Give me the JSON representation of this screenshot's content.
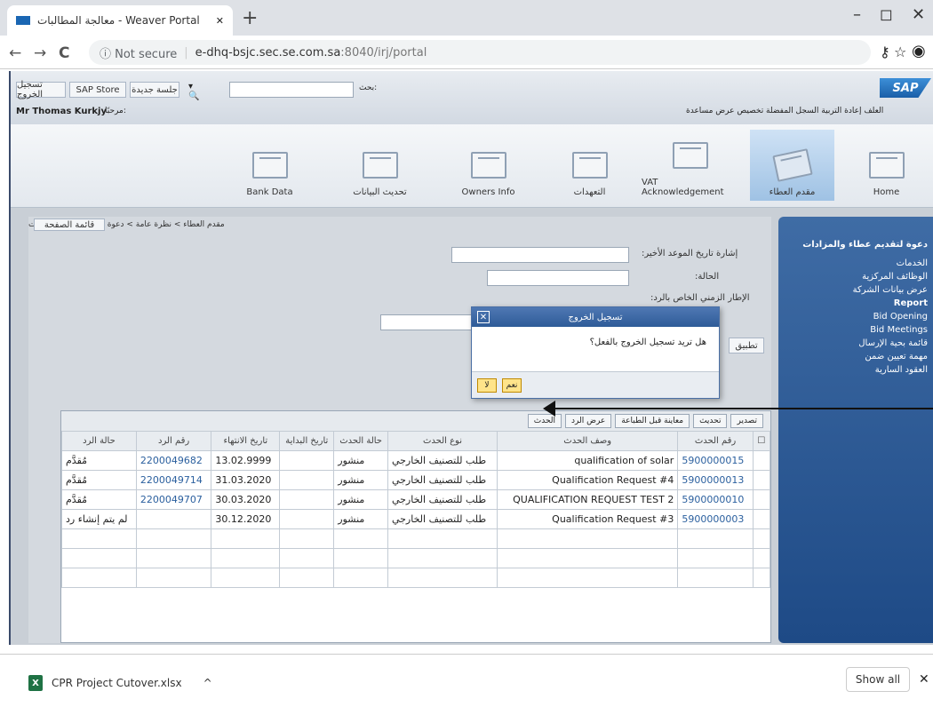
{
  "browser": {
    "tab_title": "معالجة المطالبات - Weaver Portal",
    "new_tab": "+",
    "minimize": "–",
    "maximize": "◻",
    "close": "✕",
    "back": "←",
    "forward": "→",
    "reload": "C",
    "not_secure": "ⓘ Not secure",
    "url_host": "e-dhq-bsjc.sec.se.com.sa",
    "url_rest": ":8040/irj/portal"
  },
  "sap": {
    "logo": "SAP",
    "user": "Mr Thomas Kurkjy",
    "welcome": "مرحبًا:",
    "header_links": [
      "تسجيل الخروج",
      "SAP Store",
      "جلسة جديدة"
    ],
    "search_label": "بحث:",
    "top_menu": "العلف  إعادة التربية  السجل  المفضلة  تخصيص  عرض  مساعدة",
    "nav": [
      "Home",
      "مقدم العطاء",
      "VAT Acknowledgement",
      "التعهدات",
      "Owners Info",
      "تحديث البيانات",
      "Bank Data"
    ],
    "breadcrumb": "مقدم العطاء > نظرة عامة > دعوة لتقديم عطاء والمزادات",
    "page_menu": "قائمة الصفحة",
    "panel_title": "دعوة لتقديم عطاء والمزادات",
    "panel_items": [
      "الخدمات",
      "الوظائف المركزية",
      "عرض بيانات الشركة",
      "Report",
      "Bid Opening",
      "Bid Meetings",
      "قائمة بحية الإرسال",
      "مهمة تعيين ضمن",
      "العقود السارية"
    ],
    "form_labels": [
      "إشارة تاريخ الموعد الأخير:",
      "الحالة:",
      "الإطار الزمني الخاص بالرد:"
    ],
    "apply": "تطبيق",
    "grid_buttons": [
      "تصدير",
      "تحديث",
      "معاينة قبل الطباعة",
      "عرض الرد",
      "الحدث"
    ],
    "columns": [
      "رقم الحدث",
      "وصف الحدث",
      "نوع الحدث",
      "حالة الحدث",
      "تاريخ البداية",
      "تاريخ الانتهاء",
      "رقم الرد",
      "حالة الرد"
    ],
    "rows": [
      {
        "num": "5900000015",
        "desc": "qualification of solar",
        "type": "طلب للتصنيف الخارجي",
        "status": "منشور",
        "start": "",
        "end": "13.02.9999",
        "resp": "2200049682",
        "rstatus": "مُقدَّم"
      },
      {
        "num": "5900000013",
        "desc": "Qualification Request #4",
        "type": "طلب للتصنيف الخارجي",
        "status": "منشور",
        "start": "",
        "end": "31.03.2020",
        "resp": "2200049714",
        "rstatus": "مُقدَّم"
      },
      {
        "num": "5900000010",
        "desc": "QUALIFICATION REQUEST TEST 2",
        "type": "طلب للتصنيف الخارجي",
        "status": "منشور",
        "start": "",
        "end": "30.03.2020",
        "resp": "2200049707",
        "rstatus": "مُقدَّم"
      },
      {
        "num": "5900000003",
        "desc": "Qualification Request #3",
        "type": "طلب للتصنيف الخارجي",
        "status": "منشور",
        "start": "",
        "end": "30.12.2020",
        "resp": "",
        "rstatus": "لم يتم إنشاء رد"
      }
    ]
  },
  "dialog": {
    "title": "تسجيل الخروج",
    "message": "هل تريد تسجيل الخروج بالفعل؟",
    "yes": "نعم",
    "no": "لا",
    "close": "✕"
  },
  "downloads": {
    "file": "CPR Project Cutover.xlsx",
    "show_all": "Show all",
    "chevron": "^",
    "close": "✕"
  }
}
